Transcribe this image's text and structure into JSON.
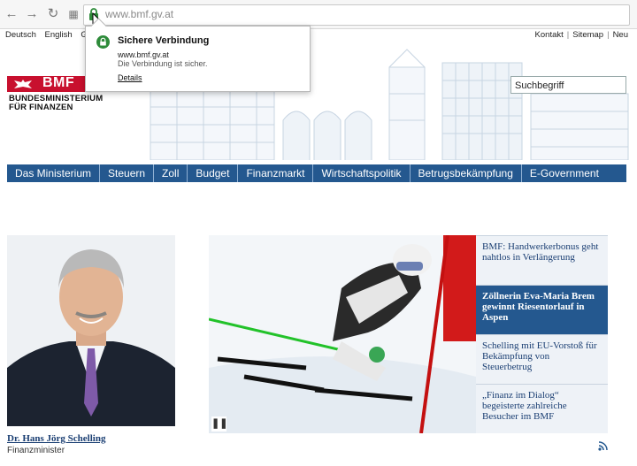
{
  "browser": {
    "url": "www.bmf.gv.at",
    "back_icon": "back-arrow-icon",
    "forward_icon": "forward-arrow-icon",
    "reload_icon": "reload-icon",
    "apps_icon": "apps-grid-icon",
    "lock_color": "#2e8b3a"
  },
  "security_popup": {
    "title": "Sichere Verbindung",
    "host": "www.bmf.gv.at",
    "message": "Die Verbindung ist sicher.",
    "details_link": "Details"
  },
  "header": {
    "languages": [
      "Deutsch",
      "English",
      "Ge"
    ],
    "links": [
      "Kontakt",
      "Sitemap",
      "Neu"
    ],
    "logo_short": "BMF",
    "logo_line1": "BUNDESMINISTERIUM",
    "logo_line2": "FÜR FINANZEN",
    "search_placeholder": "Suchbegriff",
    "brand_color": "#c8102e"
  },
  "main_nav": {
    "color": "#24588f",
    "items": [
      "Das Ministerium",
      "Steuern",
      "Zoll",
      "Budget",
      "Finanzmarkt",
      "Wirtschaftspolitik",
      "Betrugsbekämpfung",
      "E-Government"
    ]
  },
  "minister": {
    "name": "Dr. Hans Jörg Schelling",
    "role": "Finanzminister"
  },
  "slider": {
    "pause_icon": "pause-icon"
  },
  "news": [
    {
      "headline": "BMF: Handwerkerbonus geht nahtlos in Verlängerung",
      "active": false
    },
    {
      "headline": "Zöllnerin Eva-Maria Brem gewinnt Riesentorlauf in Aspen",
      "active": true
    },
    {
      "headline": "Schelling mit EU-Vorstoß für Bekämpfung von Steuerbetrug",
      "active": false
    },
    {
      "headline": "„Finanz im Dialog“ begeisterte zahlreiche Besucher im BMF",
      "active": false
    }
  ],
  "rss_icon": "rss-icon"
}
